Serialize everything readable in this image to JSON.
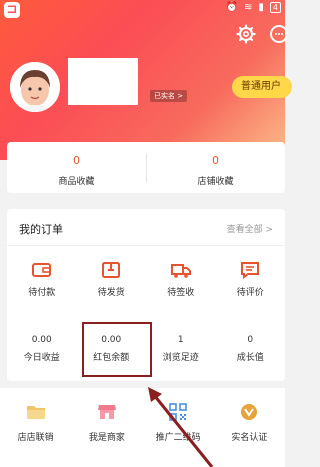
{
  "status_bar": {
    "icons": [
      "alarm-icon",
      "wifi-icon",
      "signal-icon",
      "battery-icon"
    ],
    "battery_text": "4"
  },
  "header": {
    "icons": [
      "settings-icon",
      "message-icon"
    ],
    "verify_badge": "已实名 >",
    "member_badge": "普通用户"
  },
  "favorites": [
    {
      "value": "0",
      "label": "商品收藏"
    },
    {
      "value": "0",
      "label": "店铺收藏"
    }
  ],
  "orders": {
    "title": "我的订单",
    "view_all": "查看全部 >",
    "items": [
      {
        "label": "待付款",
        "icon": "wallet-icon"
      },
      {
        "label": "待发货",
        "icon": "package-icon"
      },
      {
        "label": "待签收",
        "icon": "truck-icon"
      },
      {
        "label": "待评价",
        "icon": "comment-icon"
      }
    ],
    "stats": [
      {
        "value": "0.00",
        "label": "今日收益"
      },
      {
        "value": "0.00",
        "label": "红包余额"
      },
      {
        "value": "1",
        "label": "浏览足迹"
      },
      {
        "value": "0",
        "label": "成长值"
      }
    ]
  },
  "tools": [
    {
      "label": "店店联销",
      "icon": "folder-icon"
    },
    {
      "label": "我是商家",
      "icon": "shop-icon"
    },
    {
      "label": "推广二维码",
      "icon": "qrcode-icon"
    },
    {
      "label": "实名认证",
      "icon": "verified-icon"
    }
  ],
  "colors": {
    "accent": "#ff5a3c",
    "badge_yellow": "#ffd84a",
    "annotation": "#8a1f1f"
  }
}
